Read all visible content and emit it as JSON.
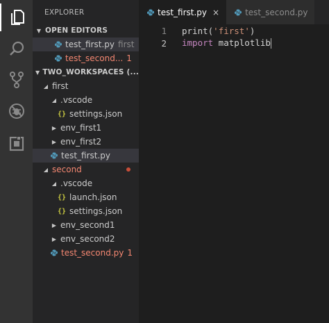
{
  "activity_bar": {
    "items": [
      {
        "icon": "files-icon"
      },
      {
        "icon": "search-icon"
      },
      {
        "icon": "source-control-icon"
      },
      {
        "icon": "debug-icon"
      },
      {
        "icon": "extensions-icon"
      }
    ]
  },
  "sidebar": {
    "title": "EXPLORER",
    "open_editors": {
      "label": "OPEN EDITORS",
      "items": [
        {
          "name": "test_first.py",
          "description": "first"
        },
        {
          "name": "test_second...",
          "badge": "1"
        }
      ]
    },
    "workspace": {
      "label": "TWO_WORKSPACES (...",
      "first": {
        "label": "first",
        "vscode": "vscode",
        "settings": "settings.json",
        "env1": "env_first1",
        "env2": "env_first2",
        "file": "test_first.py"
      },
      "second": {
        "label": "second",
        "vscode": "vscode",
        "launch": "launch.json",
        "settings": "settings.json",
        "env1": "env_second1",
        "env2": "env_second2",
        "file": "test_second.py",
        "file_badge": "1"
      }
    }
  },
  "tabs": [
    {
      "label": "test_first.py",
      "close": "×"
    },
    {
      "label": "test_second.py"
    }
  ],
  "editor": {
    "lines": [
      {
        "number": "1",
        "fn": "print",
        "open": "(",
        "str": "'first'",
        "close": ")"
      },
      {
        "number": "2",
        "kw": "import",
        "rest": " matplotlib"
      }
    ]
  },
  "colors": {
    "background": "#1e1e1e",
    "sidebar": "#252526",
    "activity_bar": "#333333",
    "error": "#f48771",
    "keyword": "#c586c0",
    "string": "#ce9178"
  }
}
